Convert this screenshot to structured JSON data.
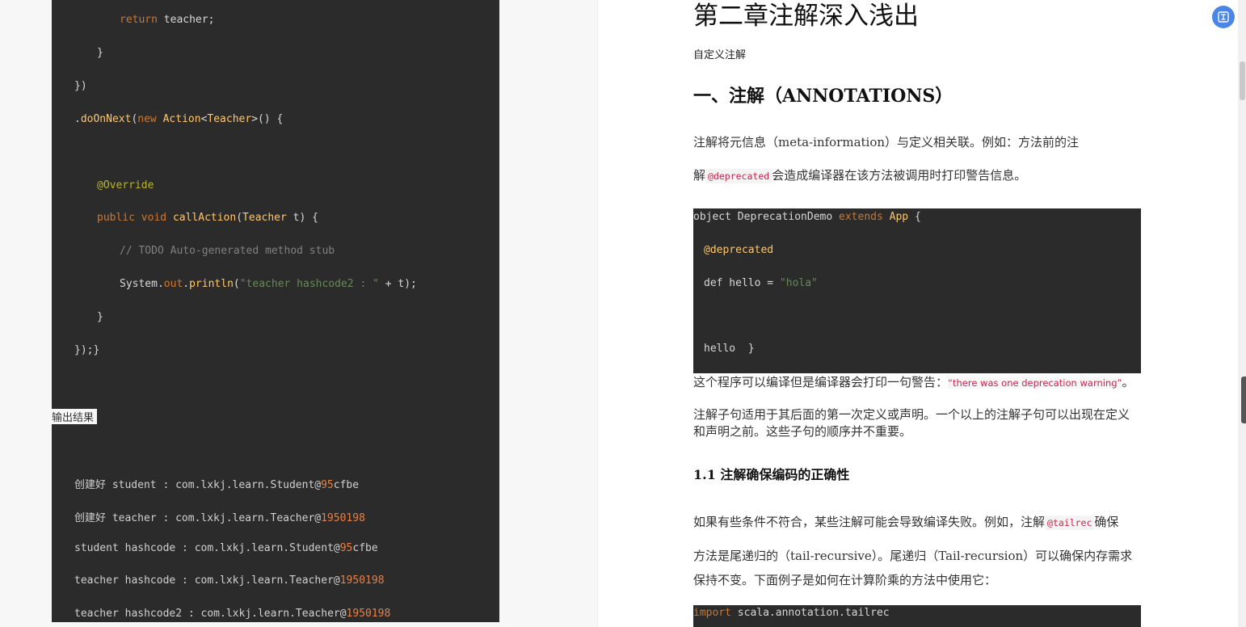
{
  "left_code": {
    "lines": [
      {
        "t": "        return teacher;"
      },
      {
        "t": "    }"
      },
      {
        "t": "})"
      },
      {
        "t": ".doOnNext(new Action<Teacher>() {"
      },
      {
        "t": "    @Override"
      },
      {
        "t": "    public void callAction(Teacher t) {"
      },
      {
        "t": "        // TODO Auto-generated method stub"
      },
      {
        "t": "        System.out.println(\"teacher hashcode2 : \" + t);"
      },
      {
        "t": "    }"
      },
      {
        "t": "});}"
      }
    ],
    "output_label": "输出结果",
    "output_lines": [
      {
        "prefix": "创建好 student : com.lxkj.learn.Student@",
        "num": "95",
        "suffix": "cfbe"
      },
      {
        "prefix": "创建好 teacher : com.lxkj.learn.Teacher@",
        "num": "1950198",
        "suffix": ""
      },
      {
        "prefix": "student hashcode : com.lxkj.learn.Student@",
        "num": "95",
        "suffix": "cfbe"
      },
      {
        "prefix": "teacher hashcode : com.lxkj.learn.Teacher@",
        "num": "1950198",
        "suffix": ""
      },
      {
        "prefix": "teacher hashcode2 : com.lxkj.learn.Teacher@",
        "num": "1950198",
        "suffix": ""
      }
    ]
  },
  "article": {
    "title": "第二章注解深入浅出",
    "subtitle": "自定义注解",
    "section1_heading": "一、注解（ANNOTATIONS）",
    "para1_line1": "注解将元信息（meta-information）与定义相关联。例如：方法前的注",
    "para1_line2_pre": "解",
    "para1_code": "@deprecated",
    "para1_line2_post": "会造成编译器在该方法被调用时打印警告信息。",
    "code_block": {
      "l1_a": "object DeprecationDemo ",
      "l1_kw": "extends",
      "l1_cls": "App",
      "l1_b": " {",
      "l2": "@deprecated",
      "l3_a": "def hello = ",
      "l3_str": "\"hola\"",
      "l4": "hello  }"
    },
    "para2_pre": "这个程序可以编译但是编译器会打印一句警告：",
    "para2_quote": "“there was one deprecation warning”",
    "para2_post": "。",
    "para3": "注解子句适用于其后面的第一次定义或声明。一个以上的注解子句可以出现在定义和声明之前。这些子句的顺序并不重要。",
    "section11_heading": "1.1 注解确保编码的正确性",
    "para4_line1_pre": "如果有些条件不符合，某些注解可能会导致编译失败。例如，注解",
    "para4_code": "@tailrec",
    "para4_line1_post": "确保",
    "para4_line2": "方法是尾递归的（tail-recursive）。尾递归（Tail-recursion）可以确保内存需求",
    "para4_line3": "保持不变。下面例子是如何在计算阶乘的方法中使用它：",
    "code_block2_kw": "import",
    "code_block2_rest": " scala.annotation.tailrec"
  },
  "icons": {
    "float_button": "translate-icon"
  },
  "colors": {
    "code_bg": "#2b2b2b",
    "keyword": "#cc7832",
    "string": "#6a8759",
    "annotation": "#bbb529",
    "accent_button": "#4a86e8"
  }
}
